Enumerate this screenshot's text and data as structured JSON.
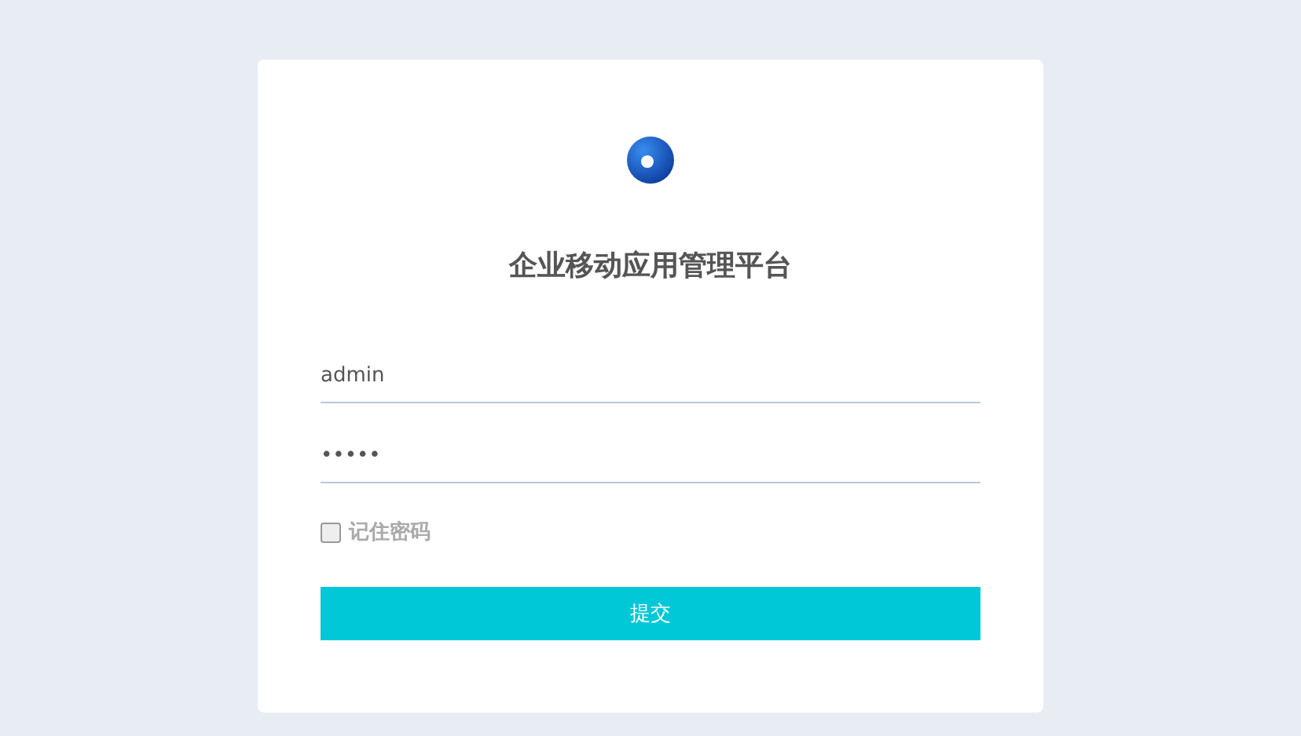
{
  "title": "企业移动应用管理平台",
  "username": {
    "value": "admin"
  },
  "password": {
    "value": "•••••"
  },
  "remember": {
    "label": "记住密码",
    "checked": false
  },
  "submit": {
    "label": "提交"
  }
}
